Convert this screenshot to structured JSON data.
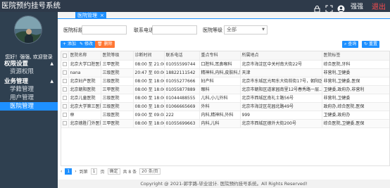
{
  "header": {
    "app_title": "医院预约挂号系统",
    "username": "强强",
    "logout": "退出"
  },
  "sidebar": {
    "welcome": "您好！强强, 欢迎登录",
    "groups": [
      {
        "title": "权限设置",
        "items": [
          "资源权限"
        ]
      },
      {
        "title": "业务管理",
        "items": [
          "学籍管理",
          "用户管理",
          "医院管理"
        ]
      }
    ],
    "active_item": "医院管理"
  },
  "tabs": [
    {
      "label": "医院管理"
    }
  ],
  "search": {
    "name_label": "医院标题",
    "phone_label": "联系电话",
    "level_label": "医院等级",
    "level_value": "全部",
    "search_button": "查询",
    "reset_button": "重置"
  },
  "toolbar": {
    "add": "添加",
    "edit": "修改",
    "delete": "删除"
  },
  "table": {
    "columns": [
      "医院名称",
      "医院等级",
      "诊断时间",
      "联系电话",
      "重点专科",
      "所属地点",
      "医院标签"
    ],
    "rows": [
      [
        "北京大学口腔医院",
        "三甲医院",
        "08:00 至 21:00",
        "01055599744",
        "口腔科,耳鼻喉科",
        "北京市海淀区中关村南大街22号",
        "综合医院,牙科"
      ],
      [
        "nana",
        "三级医院",
        "20:47 至 00:00",
        "18822111542",
        "精神科,内科,皮肤科,外科",
        "天津",
        "非营利,卫健委"
      ],
      [
        "北京妇产医院",
        "三级医院",
        "08:00 至 18:00",
        "01055277666",
        "妇产科",
        "北京市东城区光明东大街前街17号，朝阳区...",
        "非营利,卫健委,医保"
      ],
      [
        "北京朝阳医院",
        "三甲医院",
        "08:00 至 18:00",
        "01055877889",
        "眼科",
        "北京市朝阳区道家园南里12号春秀路一层...",
        "卫健委,政府办,非营利"
      ],
      [
        "北京儿童医院",
        "三级医院",
        "08:00 至 18:00",
        "01044488555",
        "儿科,小儿外科",
        "北京市西城区南礼士路56号",
        "非营利,卫健委"
      ],
      [
        "北京大学第三医院",
        "三级医院",
        "08:00 至 18:00",
        "01066665669",
        "外科",
        "北京市海淀区花园北路49号",
        "政府办,综合医院,医保"
      ],
      [
        "林",
        "三级医院",
        "09:00 至 09:08",
        "222",
        "内科,精神科,外科",
        "999",
        "卫健委,政府办"
      ],
      [
        "北京德胜门外医院",
        "三甲医院",
        "08:00 至 18:00",
        "01055699663",
        "内科,儿科",
        "北京市西城区德外大街200号",
        "综合医院,卫健委,医保"
      ]
    ]
  },
  "pager": {
    "current_page": "1",
    "goto_prefix": "到第",
    "goto_value": "1",
    "page_suffix": "页",
    "confirm": "确定",
    "total": "共 8 条",
    "per_page": "20 条/页"
  },
  "footer": {
    "text": "Copyright @ 2021-郭宇路-毕业设计. 医院预约挂号系统。All Rights Reserved!"
  },
  "colors": {
    "top_bar": "#2e3a4a",
    "sidebar": "#2f4050",
    "accent": "#1e90ff",
    "logout": "#ff4d4f",
    "add_button": "#1e90ff",
    "edit_button": "#1e90ff",
    "delete_button": "#ff7733"
  },
  "icons": {
    "lock": "lock-icon",
    "fullscreen": "fullscreen-icon",
    "user": "user-icon",
    "add": "plus-icon",
    "edit": "pencil-icon",
    "delete": "trash-icon",
    "search": "search-icon",
    "reset": "refresh-icon"
  }
}
